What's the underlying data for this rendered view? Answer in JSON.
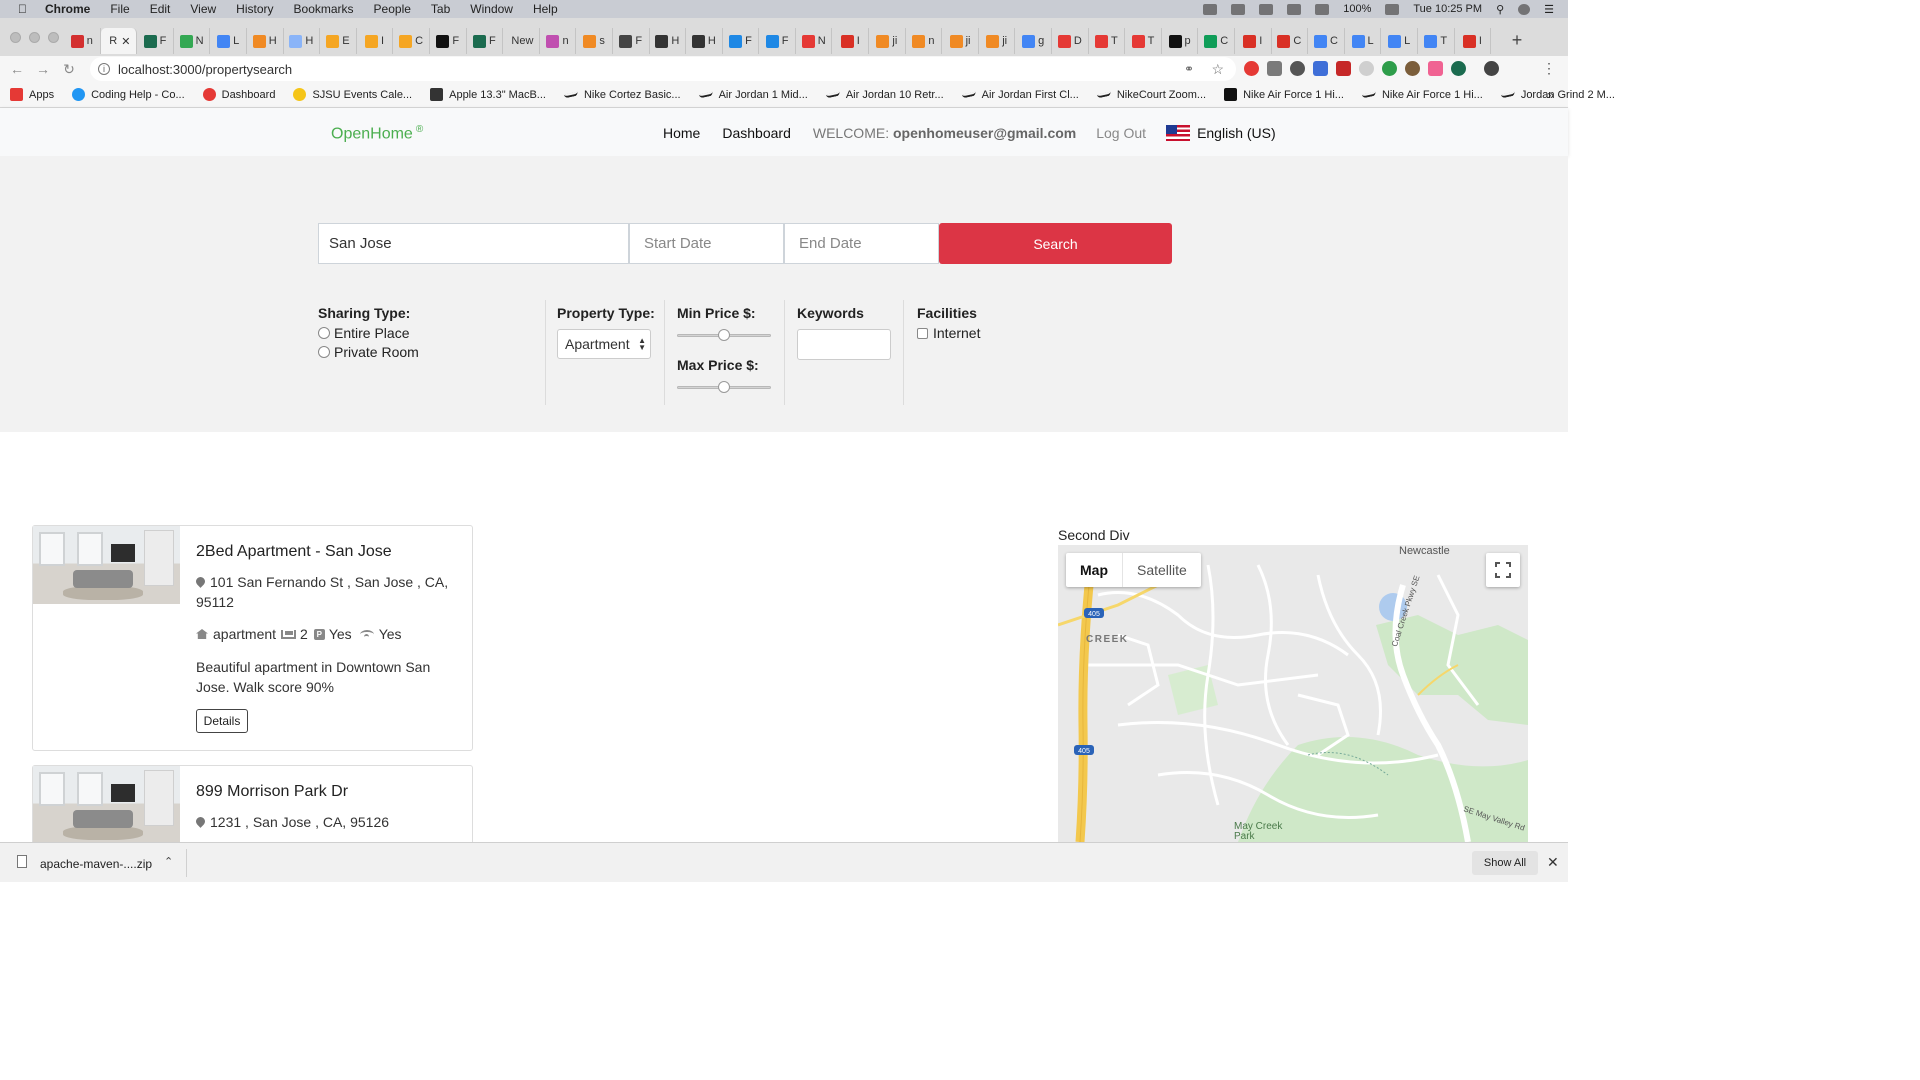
{
  "menubar": {
    "app": "Chrome",
    "items": [
      "File",
      "Edit",
      "View",
      "History",
      "Bookmarks",
      "People",
      "Tab",
      "Window",
      "Help"
    ],
    "battery": "100%",
    "clock": "Tue 10:25 PM"
  },
  "tabs": [
    {
      "label": "n",
      "color": "#d32f2f"
    },
    {
      "label": "R",
      "color": "#ffffff",
      "active": true
    },
    {
      "label": "F",
      "color": "#1b6b4f"
    },
    {
      "label": "N",
      "color": "#34a853"
    },
    {
      "label": "L",
      "color": "#4285f4"
    },
    {
      "label": "H",
      "color": "#f08a24"
    },
    {
      "label": "H",
      "color": "#8ab4f8"
    },
    {
      "label": "E",
      "color": "#f5a623"
    },
    {
      "label": "I",
      "color": "#f5a623"
    },
    {
      "label": "C",
      "color": "#f5a623"
    },
    {
      "label": "F",
      "color": "#111111"
    },
    {
      "label": "F",
      "color": "#1b6b4f"
    },
    {
      "label": "New",
      "color": "#dcdcdc"
    },
    {
      "label": "n",
      "color": "#c04fb0"
    },
    {
      "label": "s",
      "color": "#f08a24"
    },
    {
      "label": "F",
      "color": "#444444"
    },
    {
      "label": "H",
      "color": "#333333"
    },
    {
      "label": "H",
      "color": "#333333"
    },
    {
      "label": "F",
      "color": "#1e88e5"
    },
    {
      "label": "F",
      "color": "#1e88e5"
    },
    {
      "label": "N",
      "color": "#e53935"
    },
    {
      "label": "I",
      "color": "#d93025"
    },
    {
      "label": "ji",
      "color": "#f08a24"
    },
    {
      "label": "n",
      "color": "#f08a24"
    },
    {
      "label": "ji",
      "color": "#f08a24"
    },
    {
      "label": "ji",
      "color": "#f08a24"
    },
    {
      "label": "g",
      "color": "#4285f4"
    },
    {
      "label": "D",
      "color": "#e53935"
    },
    {
      "label": "T",
      "color": "#e53935"
    },
    {
      "label": "T",
      "color": "#e53935"
    },
    {
      "label": "p",
      "color": "#111111"
    },
    {
      "label": "C",
      "color": "#0f9d58"
    },
    {
      "label": "I",
      "color": "#d93025"
    },
    {
      "label": "C",
      "color": "#d93025"
    },
    {
      "label": "C",
      "color": "#4285f4"
    },
    {
      "label": "L",
      "color": "#4285f4"
    },
    {
      "label": "L",
      "color": "#4285f4"
    },
    {
      "label": "T",
      "color": "#4285f4"
    },
    {
      "label": "I",
      "color": "#d93025"
    }
  ],
  "omnibox": {
    "url": "localhost:3000/propertysearch"
  },
  "bookmarks": [
    {
      "label": "Apps",
      "icon": "apps-grid-icon",
      "color": "#e53935"
    },
    {
      "label": "Coding Help - Co...",
      "icon": "cloud-icon",
      "color": "#2196f3"
    },
    {
      "label": "Dashboard",
      "icon": "ring-icon",
      "color": "#e53935"
    },
    {
      "label": "SJSU Events Cale...",
      "icon": "sun-icon",
      "color": "#f5c518"
    },
    {
      "label": "Apple 13.3\" MacB...",
      "icon": "bh-icon",
      "color": "#333333"
    },
    {
      "label": "Nike Cortez Basic...",
      "icon": "nike-swoosh-icon",
      "color": "#222222"
    },
    {
      "label": "Air Jordan 1 Mid...",
      "icon": "nike-swoosh-icon",
      "color": "#222222"
    },
    {
      "label": "Air Jordan 10 Retr...",
      "icon": "nike-swoosh-icon",
      "color": "#222222"
    },
    {
      "label": "Air Jordan First Cl...",
      "icon": "nike-swoosh-icon",
      "color": "#222222"
    },
    {
      "label": "NikeCourt Zoom...",
      "icon": "nike-swoosh-icon",
      "color": "#222222"
    },
    {
      "label": "Nike Air Force 1 Hi...",
      "icon": "nike-box-icon",
      "color": "#111111"
    },
    {
      "label": "Nike Air Force 1 Hi...",
      "icon": "nike-swoosh-icon",
      "color": "#222222"
    },
    {
      "label": "Jordan Grind 2 M...",
      "icon": "nike-swoosh-icon",
      "color": "#222222"
    }
  ],
  "appnav": {
    "brand": "OpenHome",
    "brand_mark": "®",
    "home": "Home",
    "dashboard": "Dashboard",
    "welcome_prefix": "WELCOME:",
    "welcome_user": "openhomeuser@gmail.com",
    "logout": "Log Out",
    "language": "English (US)"
  },
  "search": {
    "location_value": "San Jose",
    "start_placeholder": "Start Date",
    "end_placeholder": "End Date",
    "button": "Search"
  },
  "filters": {
    "sharing_label": "Sharing Type:",
    "sharing_options": [
      "Entire Place",
      "Private Room"
    ],
    "property_label": "Property Type:",
    "property_value": "Apartment",
    "min_price_label": "Min Price $:",
    "max_price_label": "Max Price $:",
    "min_price_level": 0.5,
    "max_price_level": 0.5,
    "keywords_label": "Keywords",
    "facilities_label": "Facilities",
    "facility_internet": "Internet"
  },
  "listings": [
    {
      "title": "2Bed Apartment - San Jose",
      "address": "101 San Fernando St , San Jose , CA, 95112",
      "type": "apartment",
      "beds": "2",
      "parking": "Yes",
      "wifi": "Yes",
      "description": "Beautiful apartment in Downtown San Jose. Walk score 90%",
      "details_label": "Details"
    },
    {
      "title": "899 Morrison Park Dr",
      "address": "1231 , San Jose , CA, 95126"
    }
  ],
  "map": {
    "heading": "Second Div",
    "tab_map": "Map",
    "tab_satellite": "Satellite",
    "labels": {
      "newcastle": "Newcastle",
      "creek": "CREEK",
      "coal_creek": "Coal Creek Pkwy SE",
      "may_valley": "SE May Valley Rd",
      "may_creek_park": "May Creek Park",
      "hwy1": "405",
      "hwy2": "405"
    }
  },
  "downloads": {
    "file": "apache-maven-....zip",
    "show_all": "Show All"
  }
}
